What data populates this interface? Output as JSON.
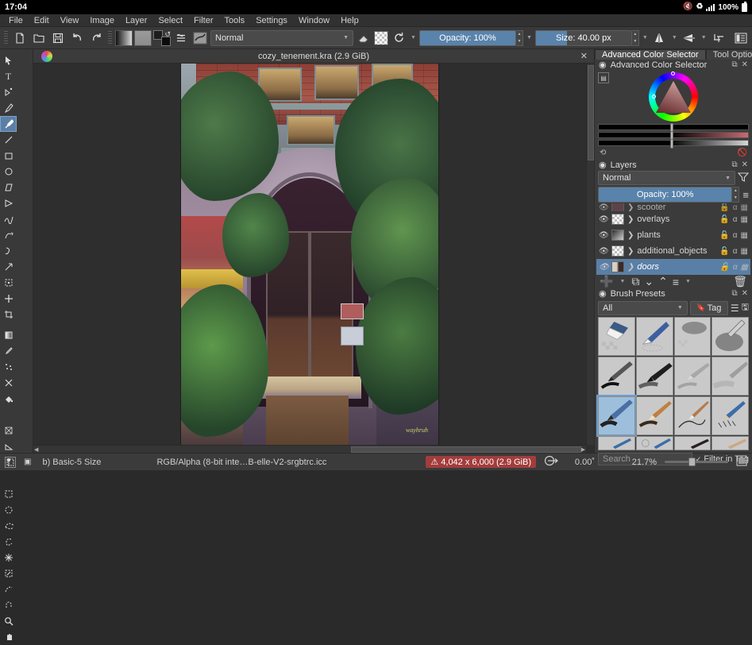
{
  "system_bar": {
    "time": "17:04",
    "battery_label": "100%",
    "icons": [
      "mute-icon",
      "wifi-icon",
      "signal-icon",
      "battery-icon"
    ]
  },
  "menubar": {
    "items": [
      "File",
      "Edit",
      "View",
      "Image",
      "Layer",
      "Select",
      "Filter",
      "Tools",
      "Settings",
      "Window",
      "Help"
    ]
  },
  "toolbar": {
    "buttons": [
      "new-document",
      "open-document",
      "save-document",
      "undo",
      "redo"
    ],
    "gradient_swatch": "gradient-swatch",
    "pattern_swatch": "pattern-swatch",
    "fgbg_swatch": "foreground-background-swatch",
    "blend_mode": "Normal",
    "eraser_label": "eraser-toggle",
    "alpha_label": "preserve-alpha-toggle",
    "reload_label": "reload-preset",
    "opacity_label": "Opacity: 100%",
    "opacity_value": 100,
    "size_label": "Size: 40.00 px",
    "size_value": 40.0,
    "mirror_h": "mirror-horizontal",
    "mirror_v": "mirror-vertical",
    "wrap": "wrap-around",
    "workspace": "workspace-chooser"
  },
  "toolbox": {
    "tools": [
      {
        "name": "select-shapes-tool",
        "glyph": "➤",
        "selected": false
      },
      {
        "name": "text-tool",
        "glyph": "T",
        "selected": false
      },
      {
        "name": "edit-shapes-tool",
        "glyph": "✐",
        "selected": false
      },
      {
        "name": "calligraphy-tool",
        "glyph": "✎",
        "selected": false
      },
      {
        "name": "freehand-brush-tool",
        "glyph": "✒",
        "selected": true
      },
      {
        "name": "line-tool",
        "glyph": "╱",
        "selected": false
      },
      {
        "name": "rectangle-tool",
        "glyph": "□",
        "selected": false
      },
      {
        "name": "ellipse-tool",
        "glyph": "○",
        "selected": false
      },
      {
        "name": "polygon-tool",
        "glyph": "⬠",
        "selected": false
      },
      {
        "name": "polyline-tool",
        "glyph": "≻",
        "selected": false
      },
      {
        "name": "bezier-curve-tool",
        "glyph": "∿",
        "selected": false
      },
      {
        "name": "freehand-path-tool",
        "glyph": "⤴",
        "selected": false
      },
      {
        "name": "dynamic-brush-tool",
        "glyph": "⤳",
        "selected": false
      },
      {
        "name": "multibrush-tool",
        "glyph": "↗",
        "selected": false
      },
      {
        "name": "transform-tool",
        "glyph": "⛶",
        "selected": false
      },
      {
        "name": "move-tool",
        "glyph": "✛",
        "selected": false
      },
      {
        "name": "crop-tool",
        "glyph": "⌧",
        "selected": false
      },
      {
        "name": "gradient-tool",
        "glyph": "◧",
        "selected": false
      },
      {
        "name": "color-sampler-tool",
        "glyph": "☂",
        "selected": false
      },
      {
        "name": "colorize-mask-tool",
        "glyph": "⁂",
        "selected": false
      },
      {
        "name": "smart-patch-tool",
        "glyph": "❉",
        "selected": false
      },
      {
        "name": "fill-tool",
        "glyph": "◣",
        "selected": false
      },
      {
        "name": "assistant-tool",
        "glyph": "⬟",
        "selected": false
      },
      {
        "name": "measure-tool",
        "glyph": "◢",
        "selected": false
      },
      {
        "name": "reference-images-tool",
        "glyph": "⚑",
        "selected": false
      },
      {
        "name": "rectangular-selection-tool",
        "glyph": "⬚",
        "selected": false
      },
      {
        "name": "elliptical-selection-tool",
        "glyph": "◌",
        "selected": false
      },
      {
        "name": "polygonal-selection-tool",
        "glyph": "⬡",
        "selected": false
      },
      {
        "name": "freehand-selection-tool",
        "glyph": "⟲",
        "selected": false
      },
      {
        "name": "contiguous-selection-tool",
        "glyph": "✳",
        "selected": false
      },
      {
        "name": "similar-color-selection-tool",
        "glyph": "⬜",
        "selected": false
      },
      {
        "name": "bezier-selection-tool",
        "glyph": "⬭",
        "selected": false
      },
      {
        "name": "magnetic-selection-tool",
        "glyph": "▭",
        "selected": false
      },
      {
        "name": "zoom-tool",
        "glyph": "⌕",
        "selected": false
      },
      {
        "name": "pan-tool",
        "glyph": "✋",
        "selected": false
      }
    ]
  },
  "document_tab": {
    "title": "cozy_tenement.kra (2.9 GiB)",
    "close_label": "✕"
  },
  "dockers": {
    "tabs": [
      {
        "label": "Advanced Color Selector",
        "active": true
      },
      {
        "label": "Tool Options",
        "active": false
      }
    ],
    "color_selector": {
      "title": "Advanced Color Selector",
      "float_icon": "⧉",
      "close_icon": "✕",
      "settings_icon": "▤"
    },
    "layers": {
      "title": "Layers",
      "blend_mode": "Normal",
      "filter_icon": "filter-icon",
      "opacity_label": "Opacity:  100%",
      "opacity_value": 100,
      "menu_icon": "≡",
      "rows": [
        {
          "name": "scooter",
          "selected": false,
          "visible": true,
          "partial": true
        },
        {
          "name": "overlays",
          "selected": false,
          "visible": true,
          "partial": false
        },
        {
          "name": "plants",
          "selected": false,
          "visible": true,
          "partial": false
        },
        {
          "name": "additional_objects",
          "selected": false,
          "visible": true,
          "partial": false
        },
        {
          "name": "doors",
          "selected": true,
          "visible": true,
          "partial": false
        }
      ],
      "buttons": [
        "add-layer",
        "duplicate-layer",
        "move-layer-down",
        "move-layer-up",
        "layer-properties",
        "delete-layer"
      ]
    },
    "brush_presets": {
      "title": "Brush Presets",
      "tag_filter": "All",
      "tag_button": "Tag",
      "search_placeholder": "Search",
      "filter_in_tag_label": "Filter in Tag",
      "filter_in_tag_checked": true,
      "selected_index": 8,
      "presets": [
        "eraser-soft",
        "eraser-small",
        "airbrush-soft",
        "airbrush-texture",
        "ink-brush-black",
        "ink-pen-black",
        "pencil-light",
        "pencil-soft",
        "basic-5-size",
        "pencil-orange",
        "ink-thin",
        "pencil-blue",
        "marker-blue",
        "blender-blue",
        "dark-round",
        "tan-chalk"
      ]
    }
  },
  "statusbar": {
    "selection_icon": "selection-mode-icon",
    "mask_icon": "mask-icon",
    "brush_preset": "b) Basic-5 Size",
    "color_profile": "RGB/Alpha (8-bit inte…B-elle-V2-srgbtrc.icc",
    "size_warning": "4,042 x 6,000 (2.9 GiB)",
    "warning_icon": "⚠",
    "fit_icon": "fit-page-icon",
    "rotation": "0.00˚",
    "zoom": "21.7%",
    "zoom_value": 21.7,
    "canvas_only_icon": "canvas-only-icon"
  },
  "artwork": {
    "description": "cozy tenement building facade painting",
    "signature": "wayhruh"
  }
}
